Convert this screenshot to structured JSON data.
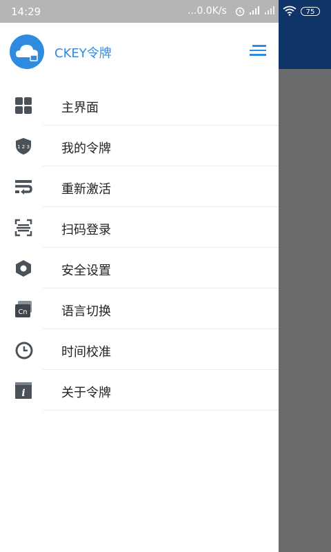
{
  "status_bar": {
    "time": "14:29",
    "network_speed": "...0.0K/s",
    "battery": "75"
  },
  "drawer": {
    "app_title": "CKEY令牌",
    "menu_items": [
      {
        "label": "主界面",
        "icon": "grid-icon"
      },
      {
        "label": "我的令牌",
        "icon": "shield-123-icon"
      },
      {
        "label": "重新激活",
        "icon": "wrap-icon"
      },
      {
        "label": "扫码登录",
        "icon": "scan-icon"
      },
      {
        "label": "安全设置",
        "icon": "hexagon-icon"
      },
      {
        "label": "语言切换",
        "icon": "language-cn-icon"
      },
      {
        "label": "时间校准",
        "icon": "clock-icon"
      },
      {
        "label": "关于令牌",
        "icon": "info-icon"
      }
    ]
  },
  "colors": {
    "accent": "#2e8be0",
    "icon_gray": "#4a5159",
    "overlay_gray": "#6b6b6b",
    "navy": "#0f3468",
    "status_bar_gray": "#b5b5b5"
  }
}
